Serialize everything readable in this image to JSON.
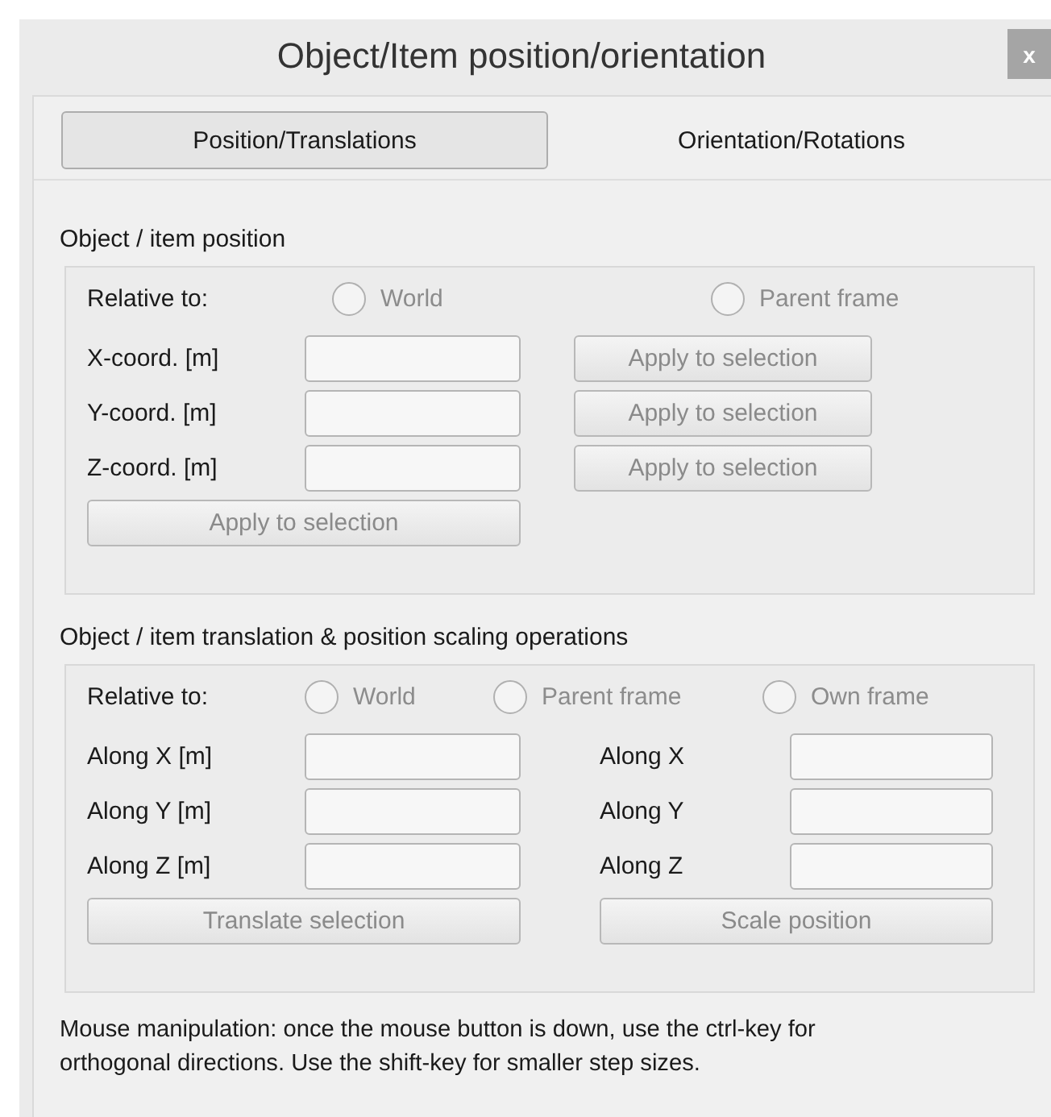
{
  "window": {
    "title": "Object/Item position/orientation",
    "close": "x"
  },
  "tabs": [
    {
      "label": "Position/Translations",
      "selected": true
    },
    {
      "label": "Orientation/Rotations",
      "selected": false
    }
  ],
  "position_group": {
    "title": "Object / item position",
    "relative_label": "Relative to:",
    "options": [
      {
        "label": "World",
        "selected": false,
        "disabled": true
      },
      {
        "label": "Parent frame",
        "selected": false,
        "disabled": true
      }
    ],
    "coords": [
      {
        "label": "X-coord. [m]",
        "button": {
          "label": "Apply to selection",
          "disabled": true
        }
      },
      {
        "label": "Y-coord. [m]",
        "button": {
          "label": "Apply to selection",
          "disabled": true
        }
      },
      {
        "label": "Z-coord. [m]",
        "button": {
          "label": "Apply to selection",
          "disabled": true
        }
      }
    ],
    "apply_all": {
      "label": "Apply to selection",
      "disabled": true
    }
  },
  "translation_group": {
    "title": "Object / item translation & position scaling operations",
    "relative_label": "Relative to:",
    "options": [
      {
        "label": "World",
        "selected": false,
        "disabled": true
      },
      {
        "label": "Parent frame",
        "selected": false,
        "disabled": true
      },
      {
        "label": "Own frame",
        "selected": false,
        "disabled": true
      }
    ],
    "translate_rows": [
      {
        "label": "Along X [m]"
      },
      {
        "label": "Along Y [m]"
      },
      {
        "label": "Along Z [m]"
      }
    ],
    "scale_rows": [
      {
        "label": "Along X"
      },
      {
        "label": "Along Y"
      },
      {
        "label": "Along Z"
      }
    ],
    "translate_button": {
      "label": "Translate selection",
      "disabled": true
    },
    "scale_button": {
      "label": "Scale position",
      "disabled": true
    }
  },
  "hint": "Mouse manipulation: once the mouse button is down, use the ctrl-key for\northogonal directions. Use the shift-key for smaller step sizes."
}
